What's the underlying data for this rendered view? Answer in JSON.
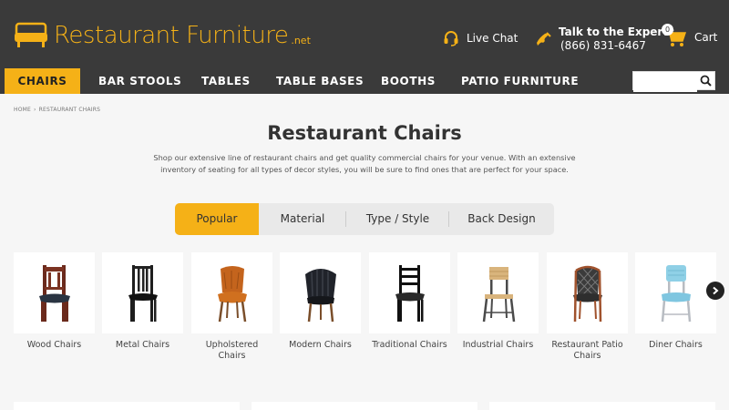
{
  "header": {
    "logo_text": "Restaurant Furniture",
    "logo_suffix": ".net",
    "live_chat": "Live Chat",
    "experts_label": "Talk to the Experts",
    "experts_phone": "(866) 831-6467",
    "cart_label": "Cart",
    "cart_count": "0"
  },
  "nav": {
    "items": [
      {
        "label": "CHAIRS"
      },
      {
        "label": "BAR STOOLS"
      },
      {
        "label": "TABLES"
      },
      {
        "label": "TABLE BASES"
      },
      {
        "label": "BOOTHS"
      },
      {
        "label": "PATIO FURNITURE"
      }
    ],
    "search_value": ""
  },
  "breadcrumb": [
    "HOME",
    "›",
    "RESTAURANT CHAIRS"
  ],
  "page": {
    "title": "Restaurant Chairs",
    "intro": "Shop our extensive line of restaurant chairs and get quality commercial chairs for your venue. With an extensive inventory of seating for all types of decor styles, you will be sure to find ones that are perfect for your space."
  },
  "tabs": [
    {
      "label": "Popular"
    },
    {
      "label": "Material"
    },
    {
      "label": "Type / Style"
    },
    {
      "label": "Back Design"
    }
  ],
  "categories": [
    {
      "label": "Wood Chairs"
    },
    {
      "label": "Metal Chairs"
    },
    {
      "label": "Upholstered Chairs"
    },
    {
      "label": "Modern Chairs"
    },
    {
      "label": "Traditional Chairs"
    },
    {
      "label": "Industrial Chairs"
    },
    {
      "label": "Restaurant Patio Chairs"
    },
    {
      "label": "Diner Chairs"
    }
  ],
  "colors": {
    "accent": "#f5b117",
    "header_bg": "#3a3a3a"
  }
}
